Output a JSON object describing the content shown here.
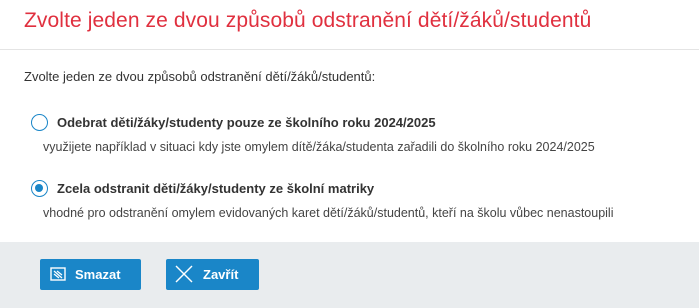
{
  "dialog": {
    "title": "Zvolte jeden ze dvou způsobů odstranění dětí/žáků/studentů",
    "intro": "Zvolte jeden ze dvou způsobů odstranění dětí/žáků/studentů:",
    "options": [
      {
        "label": "Odebrat děti/žáky/studenty pouze ze školního roku 2024/2025",
        "description": "využijete například v situaci kdy jste omylem dítě/žáka/studenta zařadili do školního roku 2024/2025",
        "selected": false
      },
      {
        "label": "Zcela odstranit děti/žáky/studenty ze školní matriky",
        "description": "vhodné pro odstranění omylem evidovaných karet dětí/žáků/studentů, kteří na školu vůbec nenastoupili",
        "selected": true
      }
    ],
    "buttons": {
      "delete_label": "Smazat",
      "delete_icon": "eraser-icon",
      "close_label": "Zavřít",
      "close_icon": "close-icon"
    }
  },
  "colors": {
    "title": "#e0303f",
    "accent": "#1a86c8",
    "footer_bg": "#e9ecee",
    "text": "#333333"
  }
}
